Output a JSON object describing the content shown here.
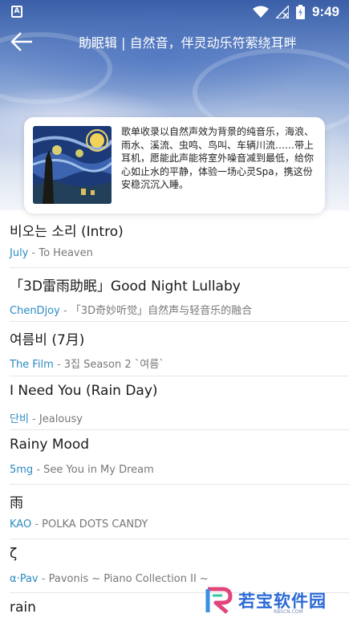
{
  "status_bar": {
    "notification_badge": "A",
    "time": "9:49"
  },
  "toolbar": {
    "title": "助眠辑 | 自然音，伴灵动乐符萦绕耳畔"
  },
  "playlist_card": {
    "description": "歌单收录以自然声效为背景的纯音乐，海浪、雨水、溪流、虫鸣、鸟叫、车辆川流……带上耳机，愿能此声能将室外噪音减到最低，给你心如止水的平静，体验一场心灵Spa，携这份安稳沉沉入睡。"
  },
  "songs": [
    {
      "title": "비오는 소리 (Intro)",
      "artist": "July",
      "separator": " - ",
      "album": "To Heaven"
    },
    {
      "title": "「3D雷雨助眠」Good Night Lullaby",
      "artist": "ChenDjoy",
      "separator": " - ",
      "album": "「3D奇妙听觉」自然声与轻音乐的融合"
    },
    {
      "title": "여름비 (7月)",
      "artist": "The Film",
      "separator": " - ",
      "album": "3집 Season 2 `여름`"
    },
    {
      "title": "I Need You (Rain Day)",
      "artist": "단비",
      "separator": " - ",
      "album": "Jealousy"
    },
    {
      "title": "Rainy Mood",
      "artist": "5mg",
      "separator": " - ",
      "album": "See You in My Dream"
    },
    {
      "title": "雨",
      "artist": "KAO",
      "separator": " - ",
      "album": "POLKA DOTS CANDY"
    },
    {
      "title": "ζ",
      "artist": "α·Pav",
      "separator": " - ",
      "album": "Pavonis ~ Piano Collection II ~"
    },
    {
      "title": "rain",
      "artist": "",
      "separator": "",
      "album": ""
    }
  ],
  "watermark": {
    "text": "若宝软件园",
    "url": "RBSCN.COM"
  },
  "colors": {
    "accent": "#2a8ac2",
    "watermark": "#2b6bd6"
  }
}
